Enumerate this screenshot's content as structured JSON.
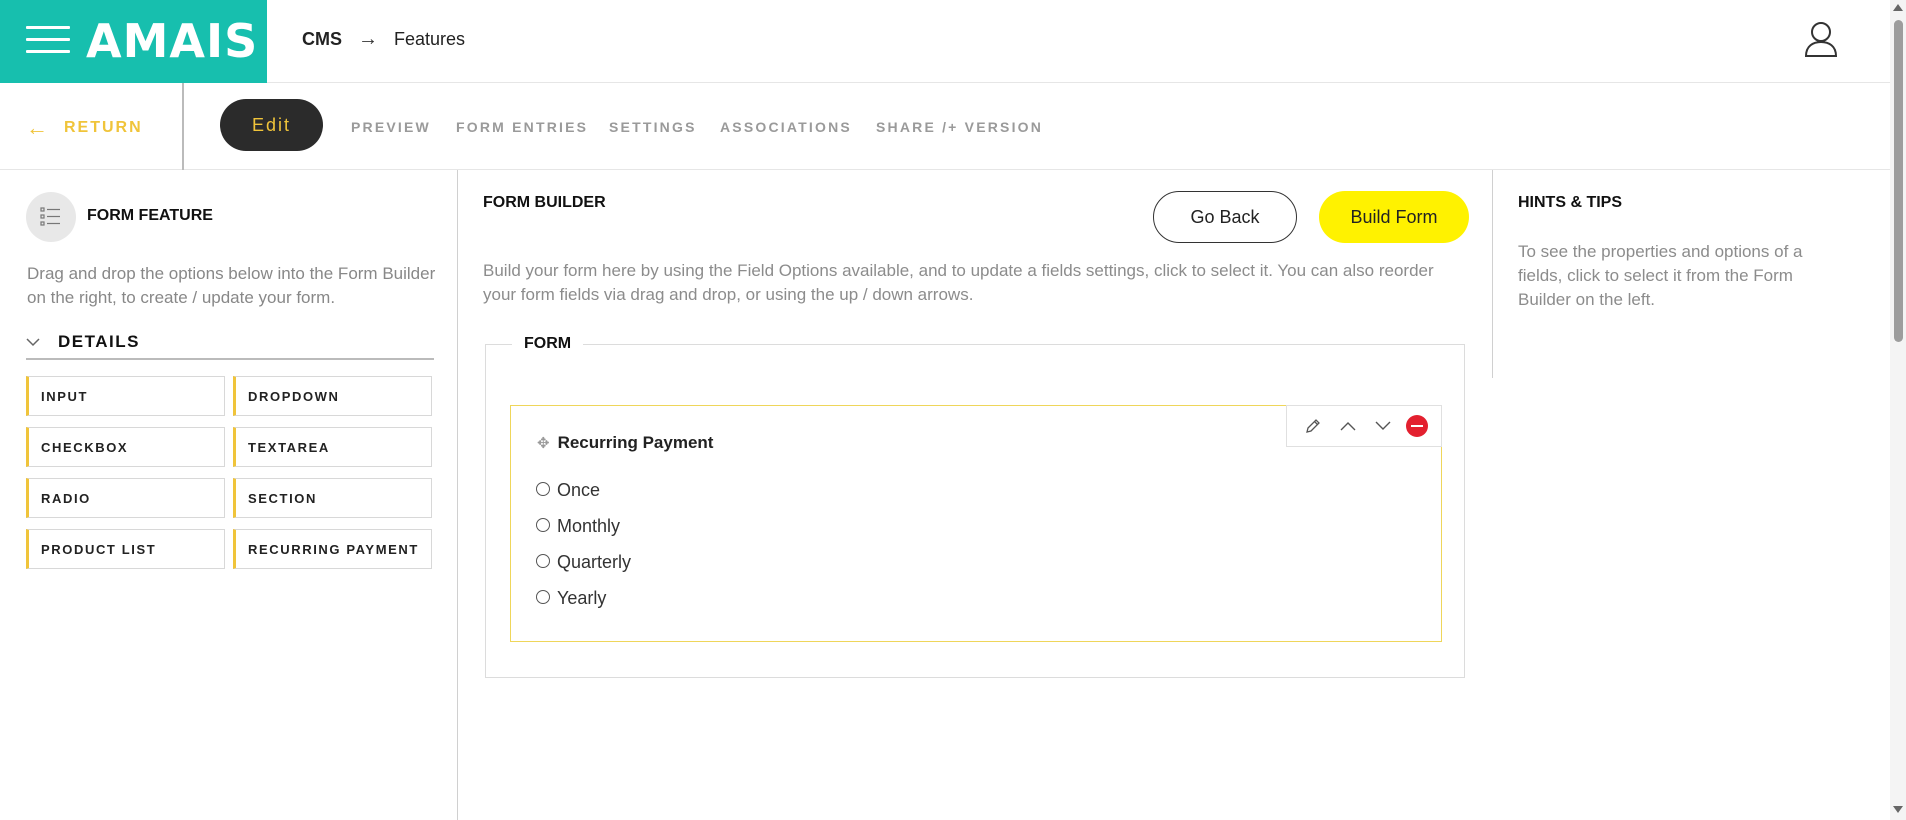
{
  "header": {
    "logo": "AMAIS",
    "breadcrumb": {
      "root": "CMS",
      "separator": "→",
      "current": "Features"
    },
    "brand_color": "#17bfae"
  },
  "tabs": {
    "return_label": "RETURN",
    "items": [
      {
        "label": "Edit",
        "active": true
      },
      {
        "label": "PREVIEW"
      },
      {
        "label": "FORM ENTRIES"
      },
      {
        "label": "SETTINGS"
      },
      {
        "label": "ASSOCIATIONS"
      },
      {
        "label": "SHARE /+ VERSION"
      }
    ]
  },
  "left_panel": {
    "title": "FORM FEATURE",
    "description": "Drag and drop the options below into the Form Builder on the right, to create / update your form.",
    "section_label": "DETAILS",
    "options": [
      "INPUT",
      "DROPDOWN",
      "CHECKBOX",
      "TEXTAREA",
      "RADIO",
      "SECTION",
      "PRODUCT LIST",
      "RECURRING PAYMENT"
    ]
  },
  "builder": {
    "title": "FORM BUILDER",
    "go_back_label": "Go Back",
    "build_form_label": "Build Form",
    "description": "Build your form here by using the Field Options available, and to update a fields settings, click to select it. You can also reorder your form fields via drag and drop, or using the up / down arrows.",
    "form_legend": "FORM",
    "field": {
      "title": "Recurring Payment",
      "options": [
        "Once",
        "Monthly",
        "Quarterly",
        "Yearly"
      ]
    }
  },
  "hints": {
    "title": "HINTS & TIPS",
    "text": "To see the properties and options of a fields, click to select it from the Form Builder on the left."
  }
}
